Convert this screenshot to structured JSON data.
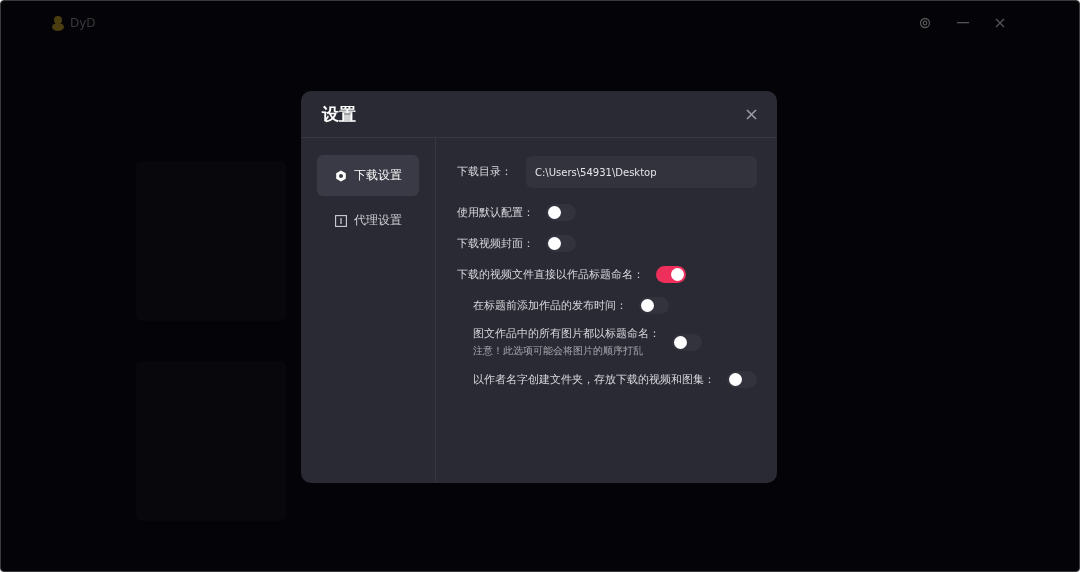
{
  "app": {
    "title": "DyD"
  },
  "dialog": {
    "title": "设置",
    "menu": [
      {
        "label": "下载设置",
        "selected": true
      },
      {
        "label": "代理设置",
        "selected": false
      }
    ],
    "directory": {
      "label": "下载目录：",
      "value": "C:\\Users\\54931\\Desktop"
    },
    "options": [
      {
        "label": "使用默认配置：",
        "on": false
      },
      {
        "label": "下载视频封面：",
        "on": false
      },
      {
        "label": "下载的视频文件直接以作品标题命名：",
        "on": true,
        "children": [
          {
            "label": "在标题前添加作品的发布时间：",
            "on": false
          },
          {
            "label": "图文作品中的所有图片都以标题命名：",
            "note": "注意！此选项可能会将图片的顺序打乱",
            "on": false
          },
          {
            "label": "以作者名字创建文件夹，存放下载的视频和图集：",
            "on": false
          }
        ]
      }
    ]
  }
}
